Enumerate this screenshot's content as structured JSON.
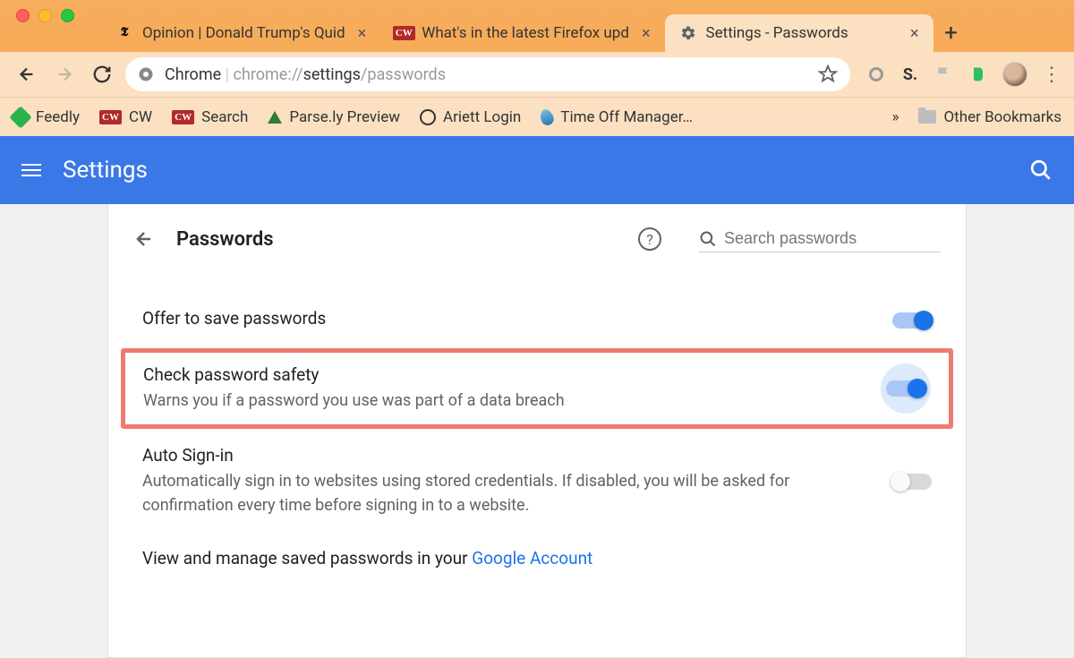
{
  "tabs": [
    {
      "title": "Opinion | Donald Trump's Quid",
      "favicon": "nyt"
    },
    {
      "title": "What's in the latest Firefox upd",
      "favicon": "cw"
    },
    {
      "title": "Settings - Passwords",
      "favicon": "gear",
      "active": true
    }
  ],
  "address": {
    "scheme": "Chrome",
    "prefix": "chrome://",
    "bold": "settings",
    "suffix": "/passwords"
  },
  "bookmarks": {
    "items": [
      "Feedly",
      "CW",
      "Search",
      "Parse.ly Preview",
      "Ariett Login",
      "Time Off Manager…"
    ],
    "overflow": "»",
    "other": "Other Bookmarks"
  },
  "settings_header": {
    "title": "Settings"
  },
  "page": {
    "title": "Passwords",
    "search_placeholder": "Search passwords",
    "rows": {
      "offer": {
        "title": "Offer to save passwords"
      },
      "check": {
        "title": "Check password safety",
        "sub": "Warns you if a password you use was part of a data breach"
      },
      "auto": {
        "title": "Auto Sign-in",
        "sub": "Automatically sign in to websites using stored credentials. If disabled, you will be asked for confirmation every time before signing in to a website."
      }
    },
    "manage": {
      "prefix": "View and manage saved passwords in your ",
      "link": "Google Account"
    }
  }
}
